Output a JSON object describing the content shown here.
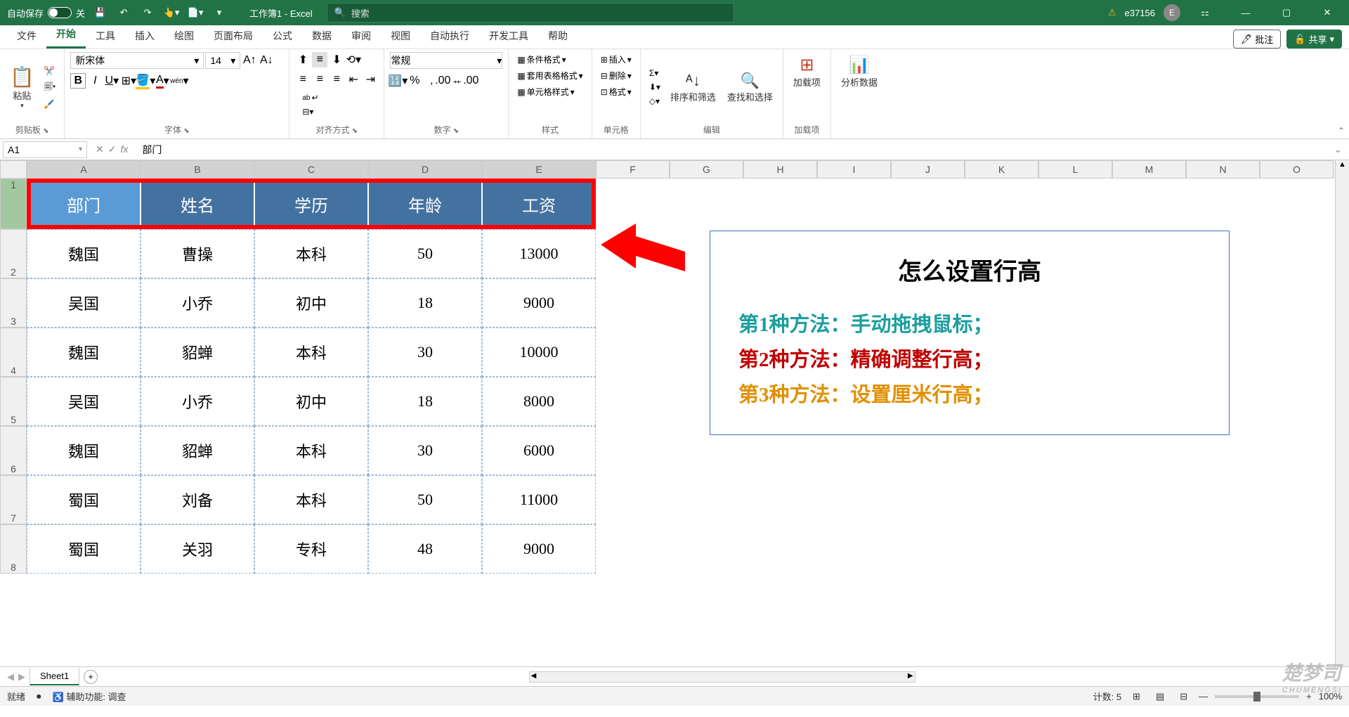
{
  "titlebar": {
    "autosave_label": "自动保存",
    "autosave_state": "关",
    "app_title": "工作簿1 - Excel",
    "search_placeholder": "搜索",
    "username": "e37156",
    "avatar_initial": "E"
  },
  "tabs": {
    "items": [
      "文件",
      "开始",
      "工具",
      "插入",
      "绘图",
      "页面布局",
      "公式",
      "数据",
      "审阅",
      "视图",
      "自动执行",
      "开发工具",
      "帮助"
    ],
    "active": "开始",
    "comments_btn": "批注",
    "share_btn": "共享"
  },
  "ribbon": {
    "clipboard": {
      "paste": "粘贴",
      "label": "剪贴板"
    },
    "font": {
      "name": "新宋体",
      "size": "14",
      "label": "字体",
      "wen": "wén"
    },
    "align": {
      "label": "对齐方式",
      "wrap": "ab"
    },
    "number": {
      "format": "常规",
      "label": "数字"
    },
    "styles": {
      "cond": "条件格式",
      "table": "套用表格格式",
      "cell": "单元格样式",
      "label": "样式"
    },
    "cells": {
      "insert": "插入",
      "delete": "删除",
      "format": "格式",
      "label": "单元格"
    },
    "editing": {
      "sort": "排序和筛选",
      "find": "查找和选择",
      "label": "编辑"
    },
    "addins": {
      "btn": "加载项",
      "label": "加载项"
    },
    "analyze": {
      "btn": "分析数据"
    }
  },
  "formula": {
    "name_box": "A1",
    "value": "部门"
  },
  "columns": [
    "A",
    "B",
    "C",
    "D",
    "E",
    "F",
    "G",
    "H",
    "I",
    "J",
    "K",
    "L",
    "M",
    "N",
    "O"
  ],
  "headers": [
    "部门",
    "姓名",
    "学历",
    "年龄",
    "工资"
  ],
  "rows": [
    [
      "魏国",
      "曹操",
      "本科",
      "50",
      "13000"
    ],
    [
      "吴国",
      "小乔",
      "初中",
      "18",
      "9000"
    ],
    [
      "魏国",
      "貂蝉",
      "本科",
      "30",
      "10000"
    ],
    [
      "吴国",
      "小乔",
      "初中",
      "18",
      "8000"
    ],
    [
      "魏国",
      "貂蝉",
      "本科",
      "30",
      "6000"
    ],
    [
      "蜀国",
      "刘备",
      "本科",
      "50",
      "11000"
    ],
    [
      "蜀国",
      "关羽",
      "专科",
      "48",
      "9000"
    ]
  ],
  "textbox": {
    "title": "怎么设置行高",
    "line1": "第1种方法：手动拖拽鼠标；",
    "line2": "第2种方法：精确调整行高；",
    "line3": "第3种方法：设置厘米行高；"
  },
  "sheets": {
    "active": "Sheet1"
  },
  "status": {
    "ready": "就绪",
    "access": "辅助功能: 调查",
    "count_label": "计数:",
    "count": "5",
    "zoom": "100%"
  },
  "watermark": {
    "main": "楚梦司",
    "sub": "CHUMENGSI"
  }
}
